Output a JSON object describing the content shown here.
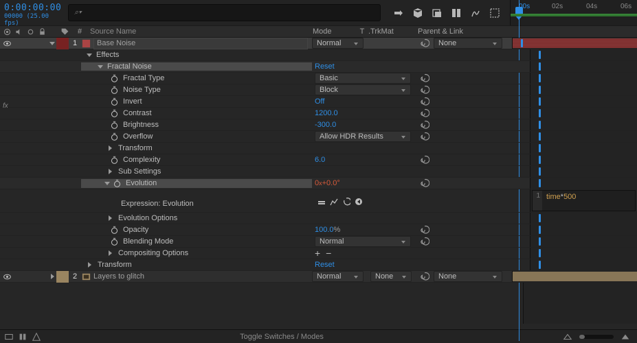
{
  "timecode": {
    "main": "0:00:00:00",
    "sub": "00000 (25.00 fps)"
  },
  "search": {
    "placeholder": "⌕▾"
  },
  "ruler": {
    "t0": "00s",
    "t1": "02s",
    "t2": "04s",
    "t3": "06s"
  },
  "columns": {
    "hash": "#",
    "source_name": "Source Name",
    "mode": "Mode",
    "t": "T",
    "trkmat": ".TrkMat",
    "parent": "Parent & Link"
  },
  "layers": [
    {
      "num": "1",
      "name": "Base Noise",
      "mode": "Normal",
      "parent": "None",
      "groups": {
        "effects": "Effects",
        "fractal": "Fractal Noise",
        "fractal_reset": "Reset",
        "props": {
          "fractal_type": {
            "label": "Fractal Type",
            "value": "Basic"
          },
          "noise_type": {
            "label": "Noise Type",
            "value": "Block"
          },
          "invert": {
            "label": "Invert",
            "value": "Off"
          },
          "contrast": {
            "label": "Contrast",
            "value": "1200.0"
          },
          "brightness": {
            "label": "Brightness",
            "value": "-300.0"
          },
          "overflow": {
            "label": "Overflow",
            "value": "Allow HDR Results"
          },
          "transform": {
            "label": "Transform"
          },
          "complexity": {
            "label": "Complexity",
            "value": "6.0"
          },
          "sub_settings": {
            "label": "Sub Settings"
          },
          "evolution": {
            "label": "Evolution",
            "value_a": "0",
            "value_x": "x",
            "value_b": "+0.0",
            "deg": "°"
          },
          "expression_label": "Expression: Evolution",
          "expression_code_a": "time",
          "expression_code_op": "*",
          "expression_code_b": "500",
          "evolution_options": {
            "label": "Evolution Options"
          },
          "opacity": {
            "label": "Opacity",
            "value": "100.0",
            "unit": " %"
          },
          "blending_mode": {
            "label": "Blending Mode",
            "value": "Normal"
          },
          "compositing": {
            "label": "Compositing Options"
          }
        },
        "transform": {
          "label": "Transform",
          "value": "Reset"
        }
      }
    },
    {
      "num": "2",
      "name": "Layers to glitch",
      "mode": "Normal",
      "trkmat": "None",
      "parent": "None"
    }
  ],
  "footer": {
    "toggle": "Toggle Switches / Modes"
  },
  "icons": {
    "fx": "fx"
  }
}
